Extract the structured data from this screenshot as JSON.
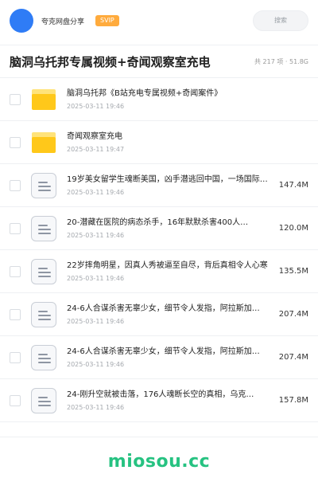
{
  "header": {
    "brand": "夸克网盘分享",
    "vip_badge": "SVIP",
    "search_placeholder": "搜索"
  },
  "share": {
    "title": "脑洞乌托邦专属视频+奇闻观察室充电",
    "summary": "共 217 项 · 51.8G"
  },
  "files": [
    {
      "type": "folder",
      "name": "脑洞乌托邦《B站充电专属视频+奇闻案件》",
      "date": "2025-03-11 19:46",
      "size": ""
    },
    {
      "type": "folder",
      "name": "奇闻观察室充电",
      "date": "2025-03-11 19:47",
      "size": ""
    },
    {
      "type": "file",
      "name": "19岁美女留学生魂断美国，凶手潜逃回中国，一场国际大追捕",
      "date": "2025-03-11 19:46",
      "size": "147.4M"
    },
    {
      "type": "file",
      "name": "20-潜藏在医院的病态杀手，16年默默杀害400人…",
      "date": "2025-03-11 19:46",
      "size": "120.0M"
    },
    {
      "type": "file",
      "name": "22岁摔角明星，因真人秀被逼至自尽，背后真相令人心寒",
      "date": "2025-03-11 19:46",
      "size": "135.5M"
    },
    {
      "type": "file",
      "name": "24-6人合谋杀害无辜少女，细节令人发指，阿拉斯加…",
      "date": "2025-03-11 19:46",
      "size": "207.4M"
    },
    {
      "type": "file",
      "name": "24-6人合谋杀害无辜少女，细节令人发指，阿拉斯加…",
      "date": "2025-03-11 19:46",
      "size": "207.4M"
    },
    {
      "type": "file",
      "name": "24-刚升空就被击落，176人魂断长空的真相，乌克…",
      "date": "2025-03-11 19:46",
      "size": "157.8M"
    }
  ],
  "footer": {
    "watermark": "miosou.cc"
  }
}
